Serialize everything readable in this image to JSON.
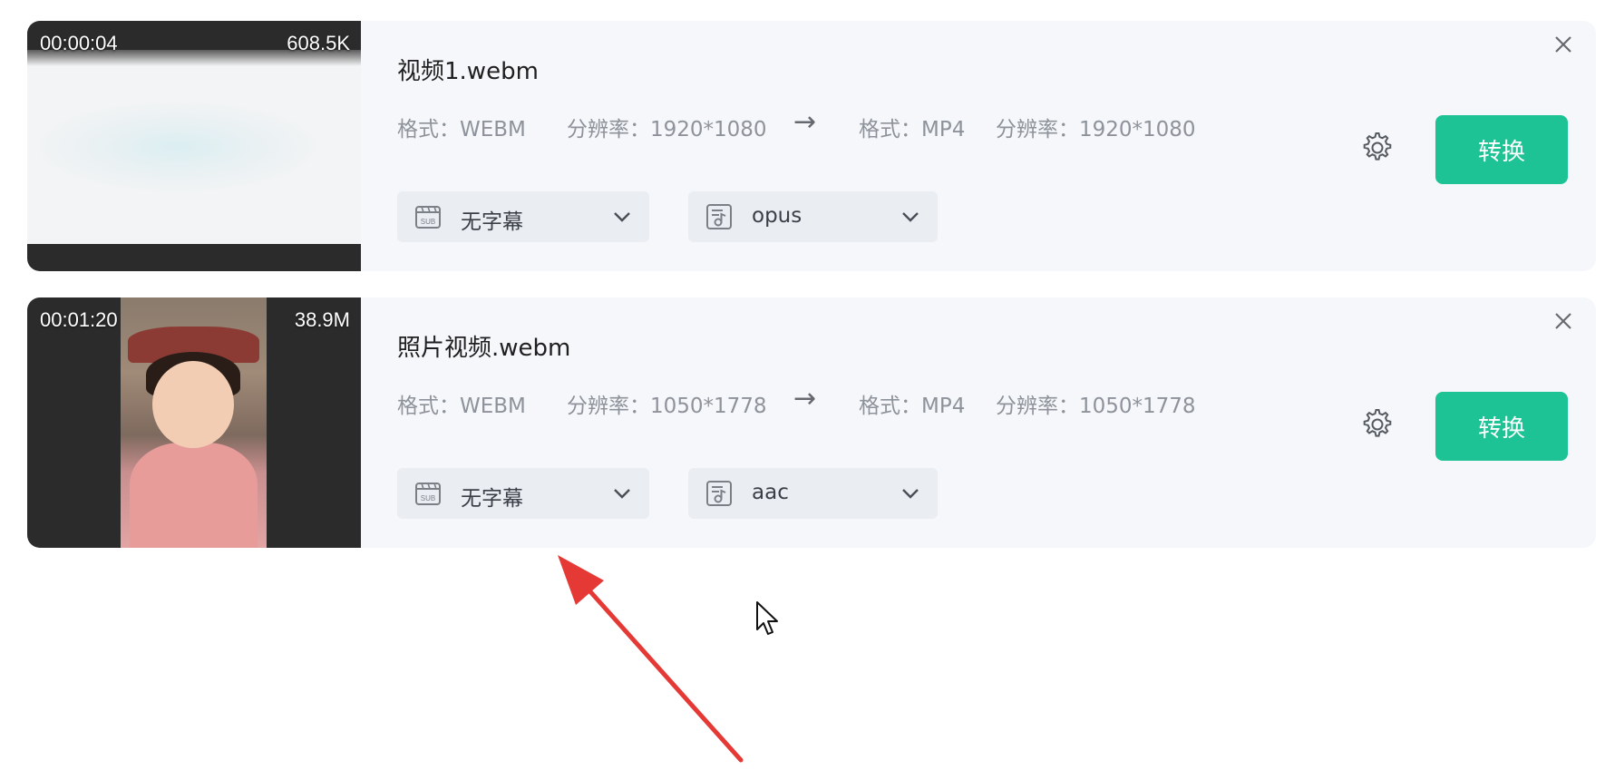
{
  "items": [
    {
      "duration": "00:00:04",
      "size": "608.5K",
      "filename": "视频1.webm",
      "src_format": "格式：WEBM",
      "src_resolution": "分辨率：1920*1080",
      "arrow": "→",
      "dst_format": "格式：MP4",
      "dst_resolution": "分辨率：1920*1080",
      "subtitle_option": "无字幕",
      "audio_option": "opus",
      "convert_label": "转换"
    },
    {
      "duration": "00:01:20",
      "size": "38.9M",
      "filename": "照片视频.webm",
      "src_format": "格式：WEBM",
      "src_resolution": "分辨率：1050*1778",
      "arrow": "→",
      "dst_format": "格式：MP4",
      "dst_resolution": "分辨率：1050*1778",
      "subtitle_option": "无字幕",
      "audio_option": "aac",
      "convert_label": "转换"
    }
  ],
  "colors": {
    "accent": "#1dc394",
    "card_bg": "#f5f7fa",
    "annotation_arrow": "#e53935"
  },
  "icons": [
    "subtitle-icon",
    "audio-track-icon",
    "chevron-down-icon",
    "gear-icon",
    "close-icon",
    "mouse-cursor-icon"
  ]
}
